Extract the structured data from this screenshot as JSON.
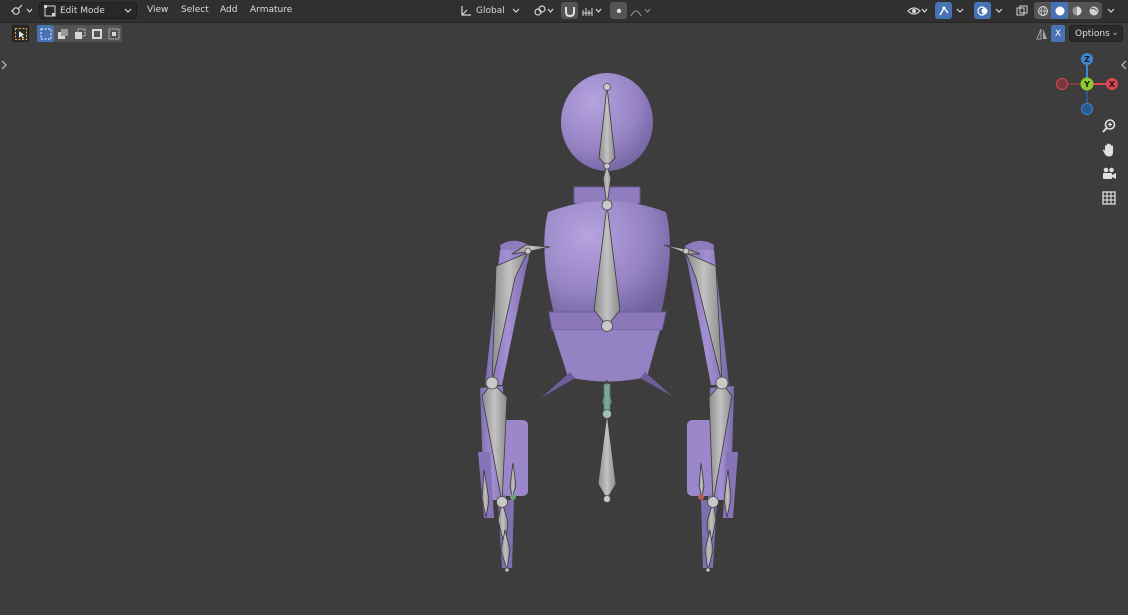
{
  "header": {
    "editor_type_icon": "3d-viewport-icon",
    "mode": {
      "icon": "armature-edit-icon",
      "label": "Edit Mode"
    },
    "menus": [
      "View",
      "Select",
      "Add",
      "Armature"
    ],
    "transform_orientation": {
      "icon": "global-orientation-icon",
      "label": "Global"
    },
    "pivot_icon": "pivot-icon",
    "snap_icon": "magnet-icon",
    "snap_target_icon": "snap-increment-icon",
    "proportional_icon": "proportional-icon",
    "falloff_icon": "falloff-curve-icon",
    "visibility_icon": "eye-selectability-icon",
    "gizmo_icon": "gizmo-icon",
    "overlay_icon": "overlay-icon",
    "xray_icon": "xray-icon",
    "shading_modes": [
      "wireframe",
      "solid",
      "material",
      "rendered"
    ],
    "active_shading": "solid"
  },
  "toolbar": {
    "active_tool_icon": "cursor-select-icon",
    "select_modes": [
      "set",
      "extend",
      "subtract",
      "invert",
      "intersect"
    ],
    "active_select_mode": "set",
    "mirror_axis_label": "X",
    "options_label": "Options"
  },
  "nav_gizmo": {
    "axes": {
      "z": "Z",
      "y": "Y",
      "x": "X"
    },
    "colors": {
      "x": "#e0434f",
      "y": "#8bcb2f",
      "z": "#3c86d6"
    }
  },
  "nav_buttons": [
    "zoom-icon",
    "hand-pan-icon",
    "camera-icon",
    "grid-ortho-icon"
  ],
  "scene": {
    "mesh_color": "#9a86c8",
    "bone_color": "#a9a9a9",
    "selected_bone_color": "#7aa895"
  }
}
